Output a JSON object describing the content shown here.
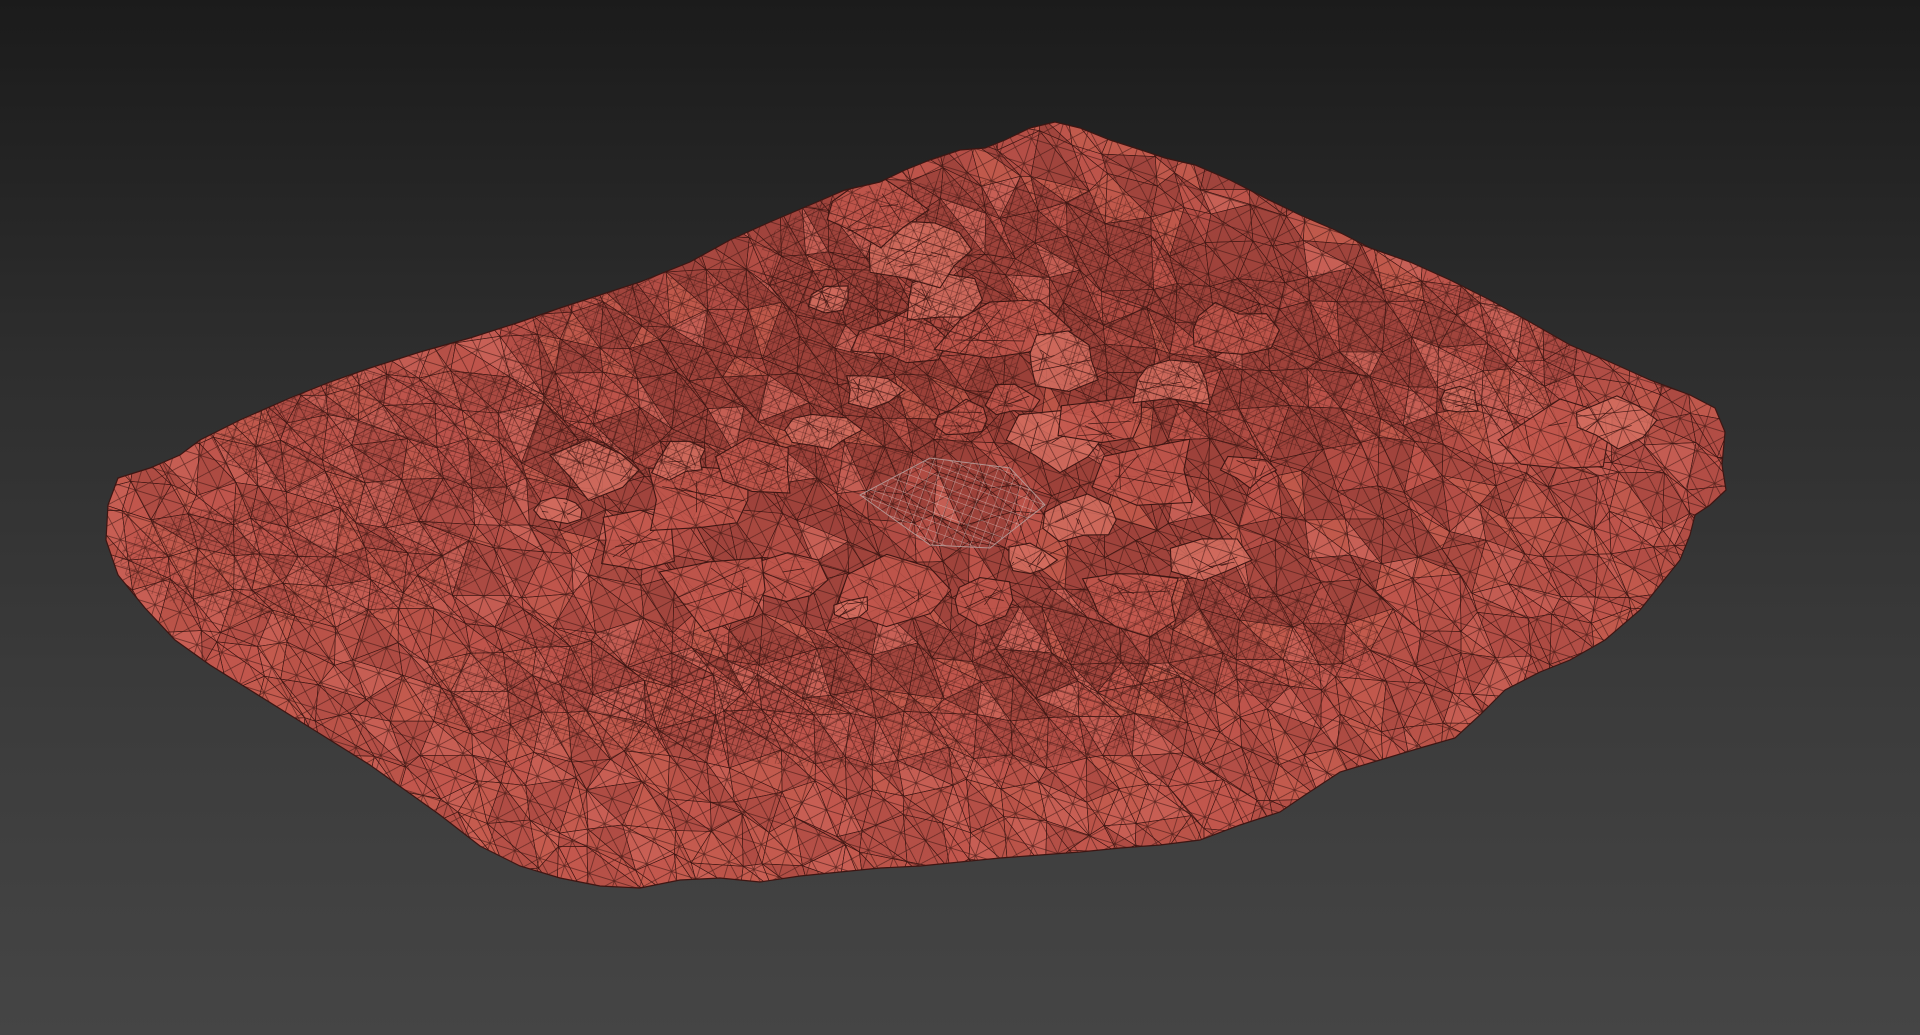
{
  "viewport": {
    "background_top": "#1b1b1b",
    "background_bottom": "#454545"
  },
  "mesh": {
    "object": "terrain-scan-mesh",
    "display_mode": "wireframe-on-shaded",
    "fill_color": "#c2574c",
    "fill_shadow_color": "#8e3a33",
    "fill_highlight_color": "#d56e60",
    "wire_color": "#3d1613",
    "selected_patch_color": "#b9a3a0"
  }
}
